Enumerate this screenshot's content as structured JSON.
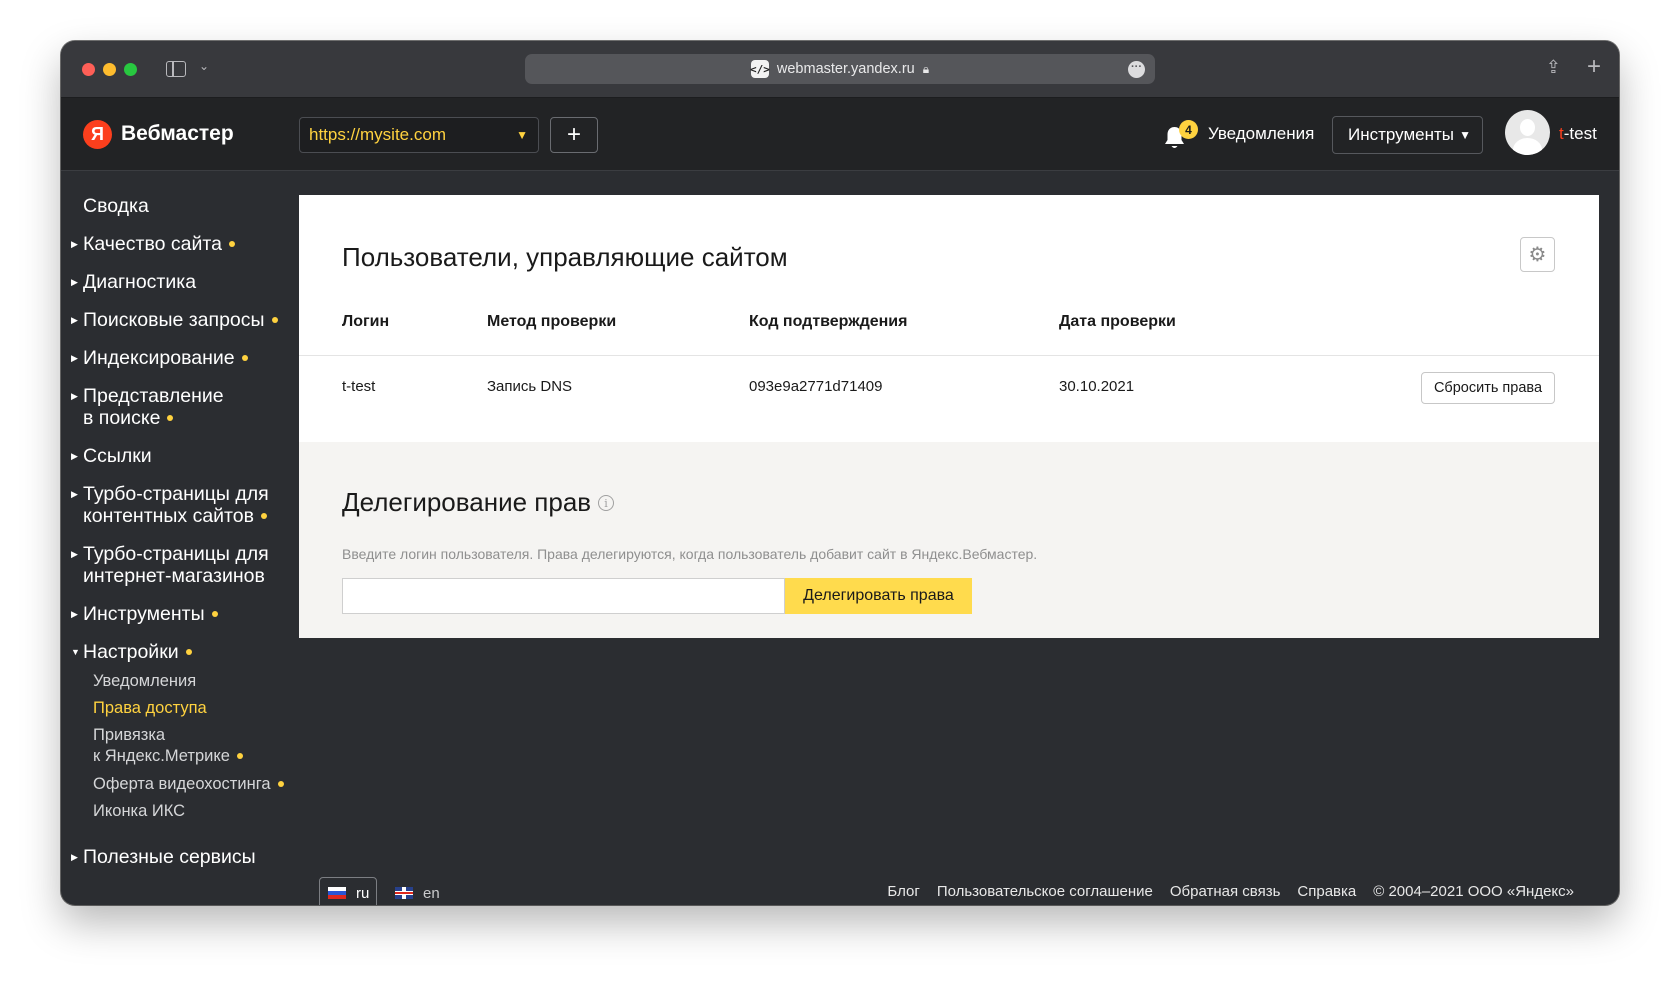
{
  "browser": {
    "url": "webmaster.yandex.ru"
  },
  "header": {
    "logo_letter": "Я",
    "logo_text": "Вебмастер",
    "site_select_value": "https://mysite.com",
    "add_site_label": "+",
    "notifications_count": "4",
    "notifications_label": "Уведомления",
    "tools_label": "Инструменты",
    "username_first": "t",
    "username_rest": "-test"
  },
  "sidebar": {
    "items": [
      {
        "label": "Сводка",
        "arrow": false,
        "dot": false
      },
      {
        "label": "Качество сайта",
        "arrow": true,
        "dot": true
      },
      {
        "label": "Диагностика",
        "arrow": true,
        "dot": false
      },
      {
        "label": "Поисковые запросы",
        "arrow": true,
        "dot": true
      },
      {
        "label": "Индексирование",
        "arrow": true,
        "dot": true
      },
      {
        "label_line1": "Представление",
        "label_line2": "в поиске",
        "arrow": true,
        "dot": true
      },
      {
        "label": "Ссылки",
        "arrow": true,
        "dot": false
      },
      {
        "label_line1": "Турбо-страницы для",
        "label_line2": "контентных сайтов",
        "arrow": true,
        "dot": true
      },
      {
        "label_line1": "Турбо-страницы для",
        "label_line2": "интернет-магазинов",
        "arrow": true,
        "dot": false
      },
      {
        "label": "Инструменты",
        "arrow": true,
        "dot": true
      },
      {
        "label": "Настройки",
        "arrow": true,
        "expanded": true,
        "dot": true
      },
      {
        "label": "Полезные сервисы",
        "arrow": true,
        "dot": false
      }
    ],
    "settings_subitems": [
      {
        "label": "Уведомления",
        "active": false,
        "dot": false
      },
      {
        "label": "Права доступа",
        "active": true,
        "dot": false
      },
      {
        "label_line1": "Привязка",
        "label_line2": "к Яндекс.Метрике",
        "active": false,
        "dot": true
      },
      {
        "label": "Оферта видеохостинга",
        "active": false,
        "dot": true
      },
      {
        "label": "Иконка ИКС",
        "active": false,
        "dot": false
      }
    ]
  },
  "main": {
    "title": "Пользователи, управляющие сайтом",
    "table": {
      "columns": [
        "Логин",
        "Метод проверки",
        "Код подтверждения",
        "Дата проверки"
      ],
      "rows": [
        [
          "t-test",
          "Запись DNS",
          "093e9a2771d71409",
          "30.10.2021"
        ]
      ],
      "reset_button": "Сбросить права"
    },
    "delegation": {
      "title": "Делегирование прав",
      "hint": "Введите логин пользователя. Права делегируются, когда пользователь добавит сайт в Яндекс.Вебмастер.",
      "input_value": "",
      "button": "Делегировать права"
    }
  },
  "footer": {
    "lang_active": "ru",
    "lang_other": "en",
    "links": [
      "Блог",
      "Пользовательское соглашение",
      "Обратная связь",
      "Справка"
    ],
    "copyright": "© 2004–2021 ООО «Яндекс»"
  },
  "colors": {
    "accent": "#ffd23f",
    "brand_red": "#fc3f1d",
    "background": "#2b2d31",
    "button_yellow": "#ffdb4d"
  }
}
